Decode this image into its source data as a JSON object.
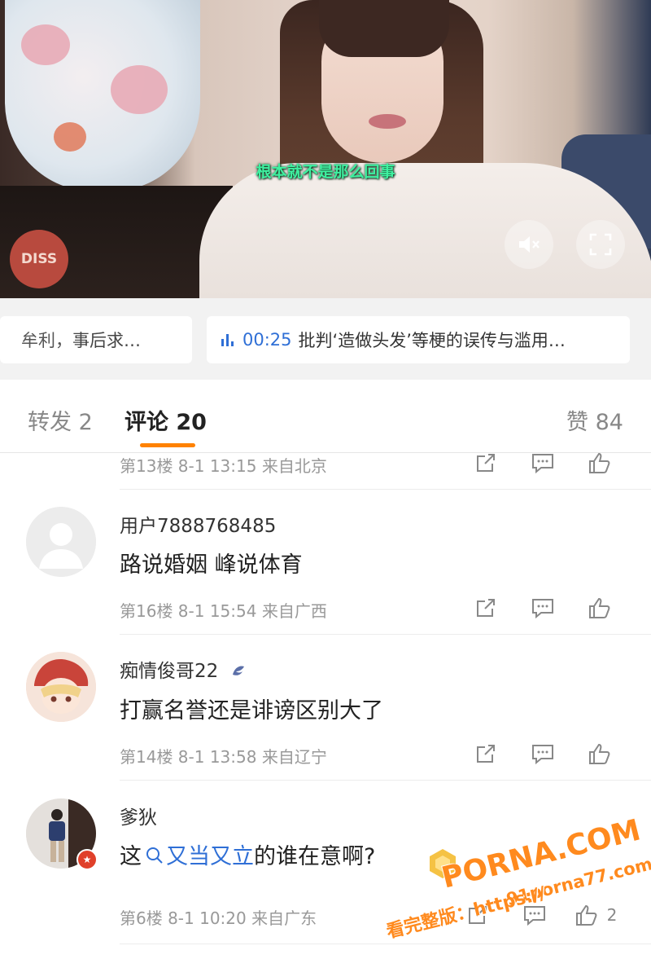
{
  "video": {
    "subtitle": "根本就不是那么回事",
    "badge": "DISS",
    "mute_icon": "mute-icon",
    "fullscreen_icon": "fullscreen-icon"
  },
  "related": {
    "left": "事后求…",
    "left_prefix": "牟利，",
    "right_time": "00:25",
    "right_title": "批判‘造做头发’等梗的误传与滥用…"
  },
  "tabs": {
    "repost": "转发 2",
    "comment": "评论 20",
    "like": "赞 84"
  },
  "comments": [
    {
      "meta": "第13楼  8-1 13:15  来自北京"
    },
    {
      "user": "用户7888768485",
      "text": "路说婚姻 峰说体育",
      "meta": "第16楼  8-1 15:54  来自广西"
    },
    {
      "user": "痴情俊哥22",
      "text": "打赢名誉还是诽谤区别大了",
      "meta": "第14楼  8-1 13:58  来自辽宁"
    },
    {
      "user": "爹狄",
      "text_pre": "这",
      "text_link": "又当又立",
      "text_post": "的谁在意啊?",
      "meta": "第6楼  8-1 10:20  来自广东",
      "likes": "2"
    }
  ],
  "watermark": {
    "site": "PORNA.COM",
    "url": "91porna77.com",
    "caption": "看完整版：https://"
  },
  "colors": {
    "accent": "#ff8200",
    "link": "#2f6fd6",
    "subtitle": "#3ff0a0"
  }
}
